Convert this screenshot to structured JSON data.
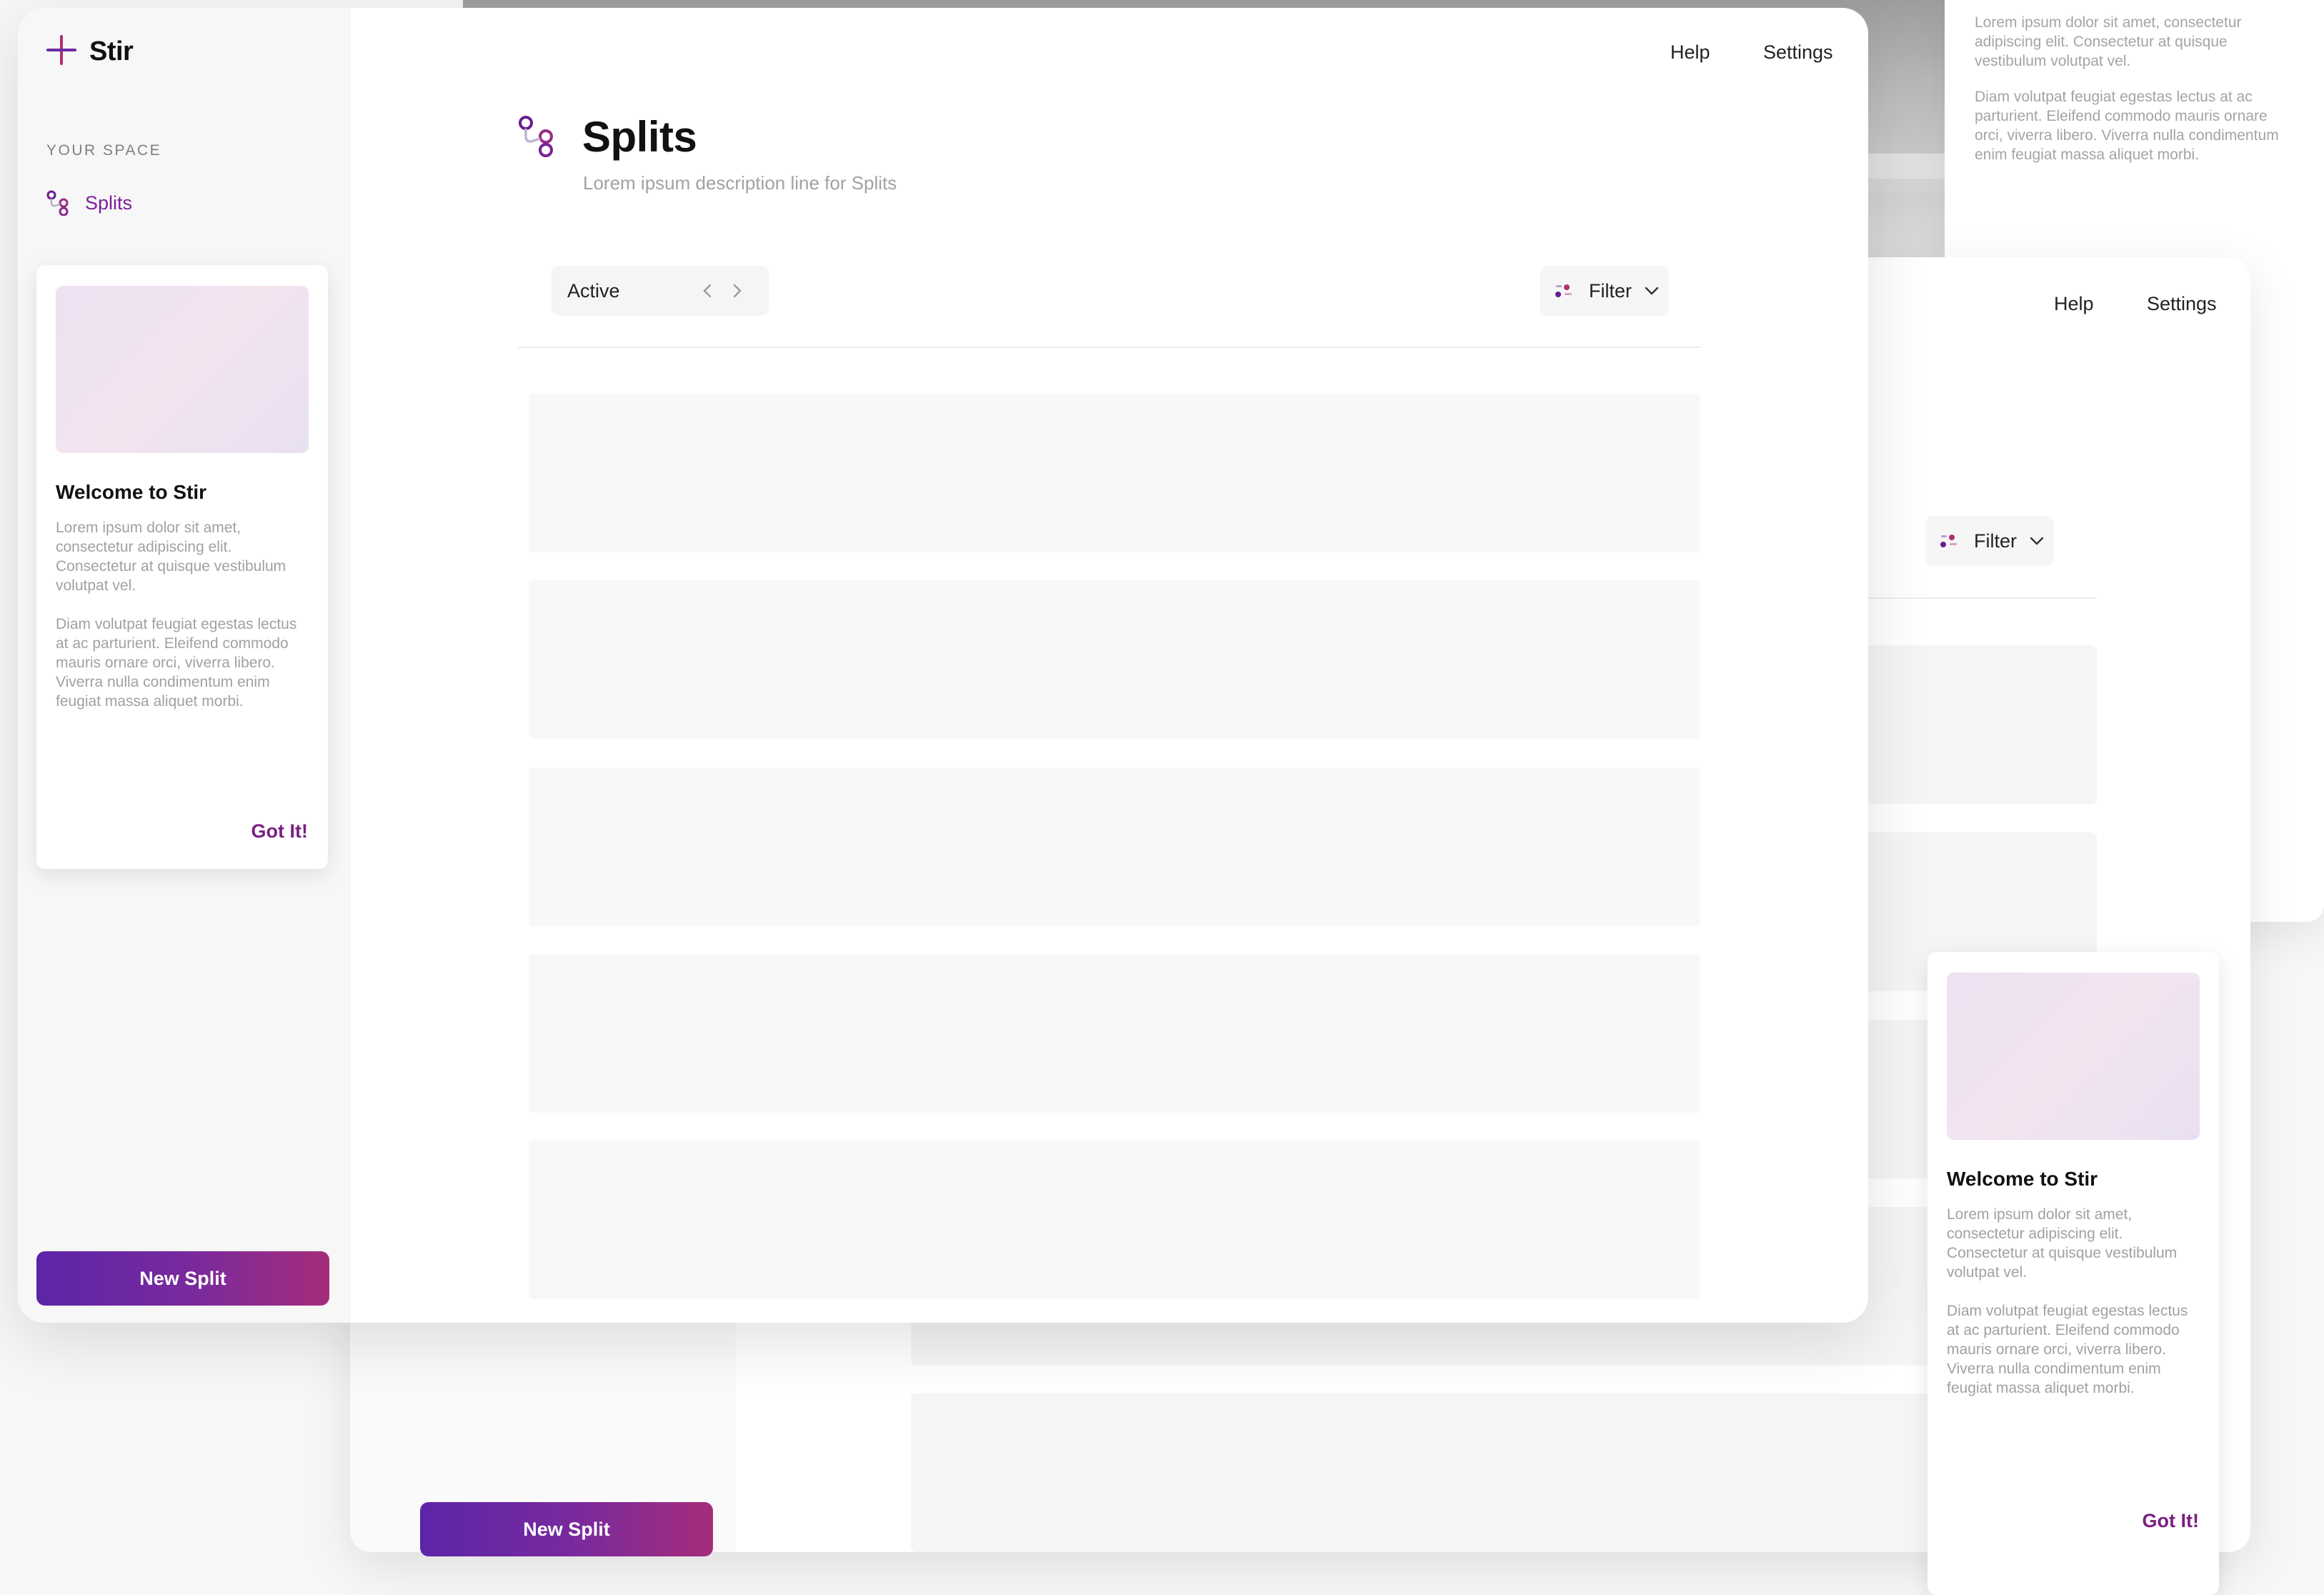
{
  "app": {
    "name": "Stir"
  },
  "header": {
    "help_label": "Help",
    "settings_label": "Settings"
  },
  "sidebar": {
    "section_label": "YOUR SPACE",
    "items": [
      {
        "label": "Splits",
        "icon": "splits-icon"
      }
    ]
  },
  "welcome": {
    "title": "Welcome to Stir",
    "paragraph1": "Lorem ipsum dolor sit amet, consectetur adipiscing elit. Consectetur at quisque vestibulum volutpat vel.",
    "paragraph2": "Diam volutpat feugiat egestas lectus at ac parturient. Eleifend commodo mauris ornare orci, viverra libero. Viverra nulla condimentum enim feugiat massa aliquet morbi.",
    "cta_label": "Got It!"
  },
  "new_split_label": "New Split",
  "page": {
    "title": "Splits",
    "description": "Lorem ipsum description line for Splits",
    "status_value": "Active",
    "filter_label": "Filter"
  },
  "background": {
    "card_paragraph1": "Lorem ipsum dolor sit amet, consectetur adipiscing elit. Consectetur at quisque vestibulum volutpat vel.",
    "card_paragraph2": "Diam volutpat feugiat egestas lectus at ac parturient. Eleifend commodo mauris ornare orci, viverra libero. Viverra nulla condimentum enim feugiat massa aliquet morbi."
  },
  "colors": {
    "accent": "#7a1f98",
    "button_start": "#5c25a8",
    "button_end": "#a52d7a"
  }
}
